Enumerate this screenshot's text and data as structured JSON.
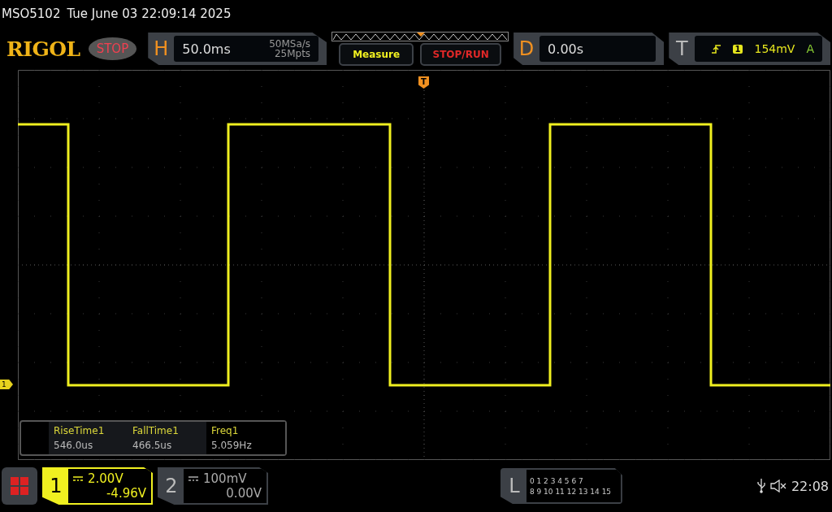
{
  "status_line": {
    "model": "MSO5102",
    "datetime": "Tue June 03 22:09:14 2025"
  },
  "header": {
    "logo": "RIGOL",
    "run_state": "STOP",
    "horizontal": {
      "label": "H",
      "timebase": "50.0ms",
      "sample_rate": "50MSa/s",
      "memory_depth": "25Mpts"
    },
    "buttons": [
      {
        "label": "Measure",
        "kind": "measure"
      },
      {
        "label": "STOP/RUN",
        "kind": "stoprun"
      }
    ],
    "delay": {
      "label": "D",
      "value": "0.00s"
    },
    "trigger": {
      "label": "T",
      "source": "1",
      "level": "154mV",
      "mode": "A"
    }
  },
  "screen": {
    "trigger_marker": "T",
    "channel_marker": "1"
  },
  "measurements": [
    {
      "name": "RiseTime1",
      "value": "546.0us"
    },
    {
      "name": "FallTime1",
      "value": "466.5us"
    },
    {
      "name": "Freq1",
      "value": "5.059Hz"
    }
  ],
  "channels": [
    {
      "number": "1",
      "scale": "2.00V",
      "offset": "-4.96V",
      "selected": true
    },
    {
      "number": "2",
      "scale": "100mV",
      "offset": "0.00V",
      "selected": false
    }
  ],
  "logic": {
    "label": "L",
    "rows": [
      "0 1 2 3  4 5 6 7",
      "8 9 10 11 12 13 14 15"
    ]
  },
  "clock": "22:08"
}
